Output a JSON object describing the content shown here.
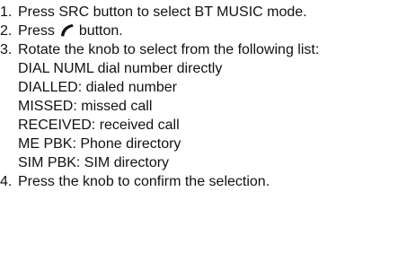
{
  "steps": [
    {
      "number": "1.",
      "text": "Press SRC button to select BT MUSIC mode."
    },
    {
      "number": "2.",
      "text_before": "Press",
      "icon": "phone-handset-icon",
      "text_after": "button."
    },
    {
      "number": "3.",
      "text": "Rotate the knob to select from the following list:",
      "options": [
        "DIAL NUML dial number directly",
        "DIALLED: dialed number",
        "MISSED: missed call",
        "RECEIVED: received call",
        "ME PBK: Phone directory",
        "SIM PBK: SIM directory"
      ]
    },
    {
      "number": "4.",
      "text": "Press the knob to confirm the selection."
    }
  ]
}
